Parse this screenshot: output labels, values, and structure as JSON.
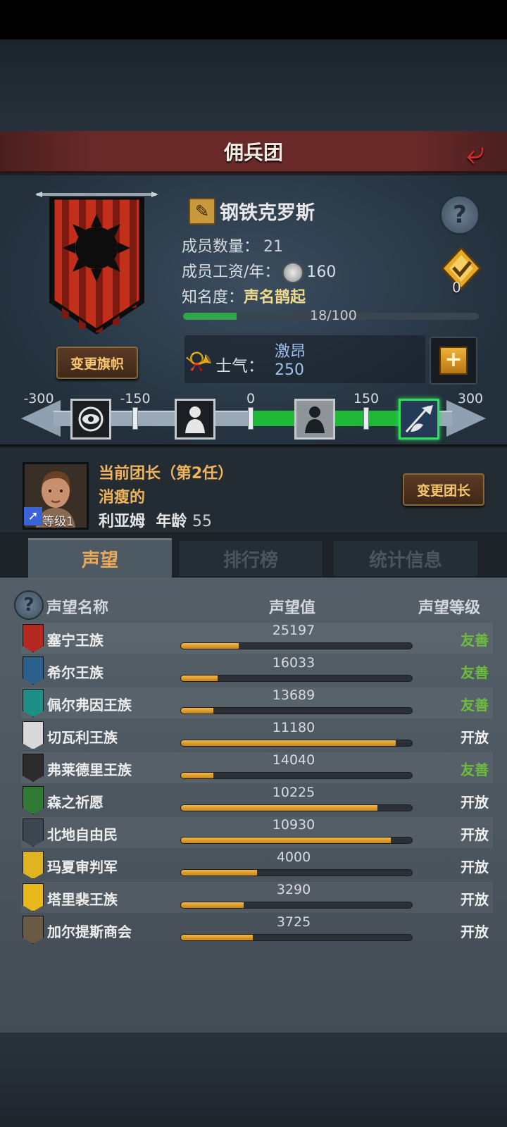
{
  "header": {
    "title": "佣兵团",
    "back_icon": "back-arrow-icon"
  },
  "guild": {
    "name": "钢铁克罗斯",
    "members_label": "成员数量：",
    "members_value": "21",
    "salary_label": "成员工资/年：",
    "salary_value": "160",
    "fame_label": "知名度：",
    "fame_value": "声名鹊起",
    "fame_progress_text": "18/100",
    "fame_progress": 0.18,
    "badge_count": "0",
    "change_flag_label": "变更旗帜"
  },
  "morale": {
    "label": "士气：",
    "state": "激昂",
    "value": "250",
    "ticks": [
      "-300",
      "-150",
      "0",
      "150",
      "300"
    ],
    "range": [
      -300,
      300
    ],
    "current": 250
  },
  "leader": {
    "title": "当前团长（第2任）",
    "trait": "消瘦的",
    "name": "利亚姆",
    "age_label": "年龄",
    "age": "55",
    "level": "等级1",
    "change_label": "变更团长"
  },
  "tabs": [
    {
      "label": "声望",
      "active": true
    },
    {
      "label": "排行榜",
      "active": false
    },
    {
      "label": "统计信息",
      "active": false
    }
  ],
  "table": {
    "col_name": "声望名称",
    "col_value": "声望值",
    "col_level": "声望等级",
    "rows": [
      {
        "name": "塞宁王族",
        "value": "25197",
        "level": "友善",
        "fill": 0.25,
        "color": "#b5281f"
      },
      {
        "name": "希尔王族",
        "value": "16033",
        "level": "友善",
        "fill": 0.16,
        "color": "#2b5f8c"
      },
      {
        "name": "佩尔弗因王族",
        "value": "13689",
        "level": "友善",
        "fill": 0.14,
        "color": "#1d8f86"
      },
      {
        "name": "切瓦利王族",
        "value": "11180",
        "level": "开放",
        "fill": 0.93,
        "color": "#d9d9d9"
      },
      {
        "name": "弗莱德里王族",
        "value": "14040",
        "level": "友善",
        "fill": 0.14,
        "color": "#2c2c2c"
      },
      {
        "name": "森之祈愿",
        "value": "10225",
        "level": "开放",
        "fill": 0.85,
        "color": "#2f7a34"
      },
      {
        "name": "北地自由民",
        "value": "10930",
        "level": "开放",
        "fill": 0.91,
        "color": "#3a4650"
      },
      {
        "name": "玛夏审判军",
        "value": "4000",
        "level": "开放",
        "fill": 0.33,
        "color": "#e0b320"
      },
      {
        "name": "塔里裴王族",
        "value": "3290",
        "level": "开放",
        "fill": 0.27,
        "color": "#e8b81a"
      },
      {
        "name": "加尔提斯商会",
        "value": "3725",
        "level": "开放",
        "fill": 0.31,
        "color": "#6a5a44"
      }
    ]
  }
}
